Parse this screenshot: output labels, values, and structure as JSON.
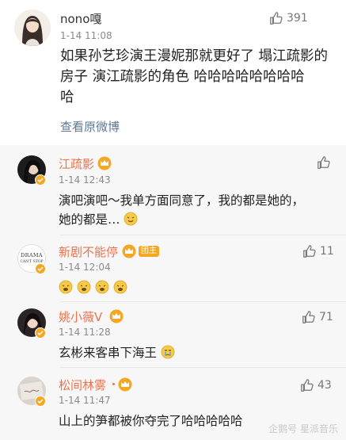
{
  "post": {
    "username": "nono嘎",
    "time": "1-14 11:08",
    "like_count": "391",
    "text_lines": [
      "如果孙艺珍演王漫妮那就更好了 塌江疏影的",
      "房子 演江疏影的角色 哈哈哈哈哈哈哈哈",
      "哈"
    ],
    "view_original_label": "查看原微博"
  },
  "comments": [
    {
      "username": "江疏影",
      "time": "1-14 12:43",
      "like_count": "",
      "lines": [
        "演吧演吧～我单方面同意了，我的都是她的，",
        "她的都是…"
      ],
      "emojis": [
        "grin-emoji"
      ]
    },
    {
      "username": "新剧不能停",
      "vip_label": "团主",
      "time": "1-14 12:04",
      "like_count": "11",
      "avatar_text": [
        "DRAMA",
        "CAN'T STOP"
      ],
      "emojis": [
        "laugh-emoji",
        "laugh-emoji",
        "laugh-emoji",
        "laugh-emoji"
      ]
    },
    {
      "username": "姚小薇V",
      "time": "1-14 11:28",
      "like_count": "71",
      "lines": [
        "玄彬来客串下海王"
      ],
      "emojis": [
        "cry-emoji"
      ]
    },
    {
      "username": "松间林雾",
      "time": "1-14 11:47",
      "like_count": "43",
      "lines": [
        "山上的笋都被你夺完了哈哈哈哈哈"
      ]
    }
  ],
  "watermark": "企鹅号 星派音乐",
  "colors": {
    "username_comment": "#eb7350",
    "link": "#5d7895",
    "comment_bg": "#f7f7f7",
    "vip_badge": "#f5a623"
  }
}
